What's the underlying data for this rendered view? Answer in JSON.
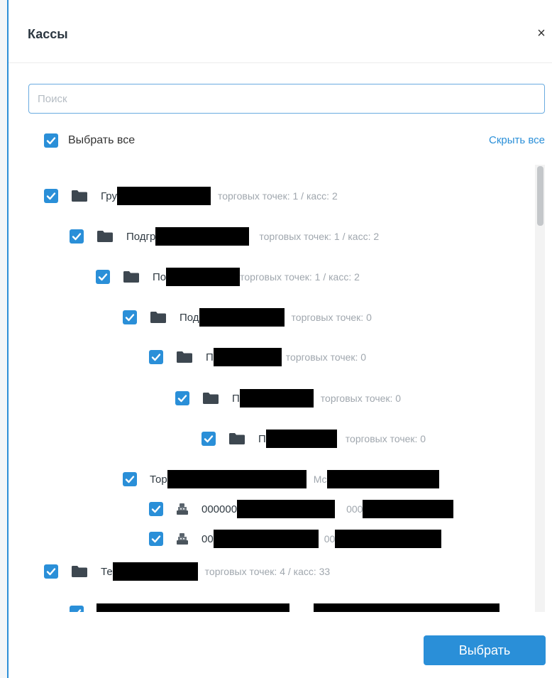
{
  "dialog": {
    "title": "Кассы",
    "close_glyph": "×",
    "search_placeholder": "Поиск",
    "select_all_label": "Выбрать все",
    "hide_all_label": "Скрыть все",
    "submit_label": "Выбрать"
  },
  "tree": [
    {
      "icon": "folder-icon",
      "name": "Гру",
      "meta": "торговых точек: 1 / касс: 2",
      "checked": true
    },
    {
      "icon": "folder-icon",
      "name": "Подгр",
      "meta": "торговых точек: 1 / касс: 2",
      "checked": true
    },
    {
      "icon": "folder-icon",
      "name": "По",
      "meta": "торговых точек: 1 / касс: 2",
      "checked": true
    },
    {
      "icon": "folder-icon",
      "name": "Под",
      "meta": "торговых точек: 0",
      "checked": true
    },
    {
      "icon": "folder-icon",
      "name": "П",
      "meta": "торговых точек: 0",
      "checked": true
    },
    {
      "icon": "folder-icon",
      "name": "П",
      "meta": "торговых точек: 0",
      "checked": true
    },
    {
      "icon": "folder-icon",
      "name": "П",
      "meta": "торговых точек: 0",
      "checked": true
    },
    {
      "icon": "none",
      "name": "Тор",
      "meta": "Мс",
      "checked": true
    },
    {
      "icon": "cash-register-icon",
      "name": "000000",
      "meta": "000",
      "checked": true
    },
    {
      "icon": "cash-register-icon",
      "name": "00",
      "meta": "00",
      "checked": true
    },
    {
      "icon": "folder-icon",
      "name": "Те",
      "meta": "торговых точек: 4 / касс: 33",
      "checked": true
    },
    {
      "icon": "none",
      "name": "",
      "meta": "",
      "checked": true
    }
  ],
  "colors": {
    "accent": "#2a8fd8",
    "folder": "#3d4750",
    "muted_text": "#a0a7ae"
  }
}
